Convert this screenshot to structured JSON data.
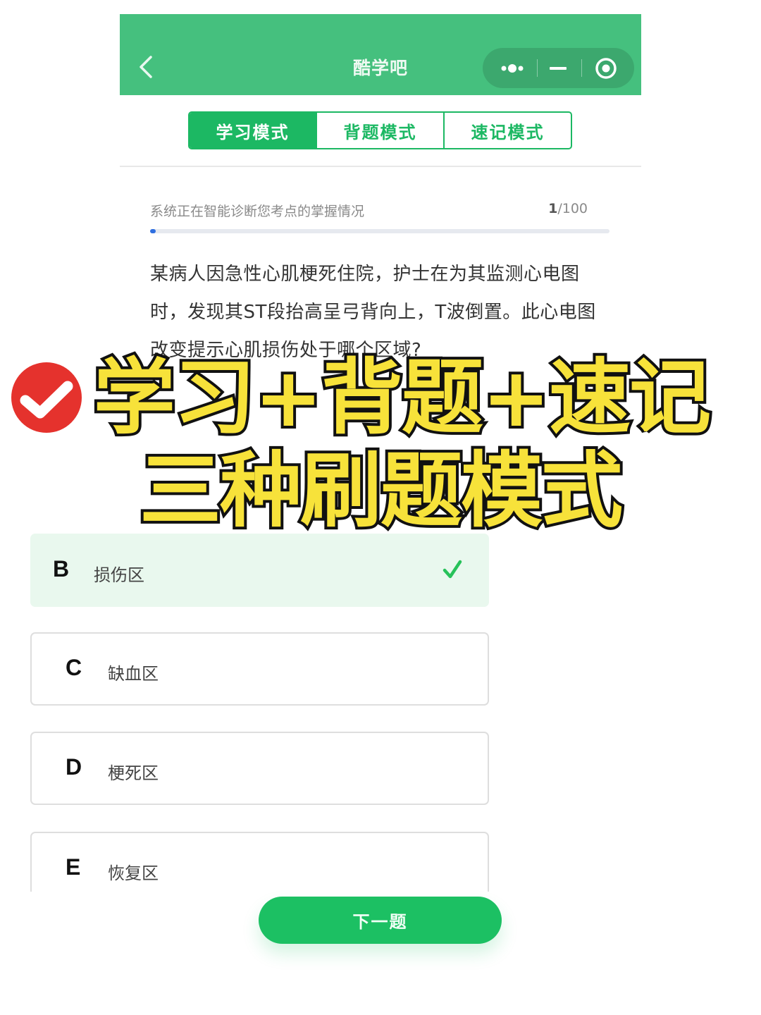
{
  "header": {
    "title": "酷学吧"
  },
  "tabs": [
    {
      "label": "学习模式",
      "active": true
    },
    {
      "label": "背题模式",
      "active": false
    },
    {
      "label": "速记模式",
      "active": false
    }
  ],
  "progress": {
    "label": "系统正在智能诊断您考点的掌握情况",
    "current": "1",
    "total": "/100",
    "fraction": 0.01
  },
  "question": {
    "text": "某病人因急性心肌梗死住院，护士在为其监测心电图时，发现其ST段抬高呈弓背向上，T波倒置。此心电图改变提示心肌损伤处于哪个区域?"
  },
  "options": [
    {
      "letter": "B",
      "text": "损伤区",
      "correct": true
    },
    {
      "letter": "C",
      "text": "缺血区",
      "correct": false
    },
    {
      "letter": "D",
      "text": "梗死区",
      "correct": false
    },
    {
      "letter": "E",
      "text": "恢复区",
      "correct": false
    }
  ],
  "next_button": {
    "label": "下一题"
  },
  "overlay": {
    "line1": "学习+背题+速记",
    "line2": "三种刷题模式"
  },
  "colors": {
    "header_green": "#45c07e",
    "accent_green": "#1cb863",
    "progress_blue": "#2f6fe0",
    "headline_yellow": "#f7e23a",
    "badge_red": "#e5322d"
  }
}
